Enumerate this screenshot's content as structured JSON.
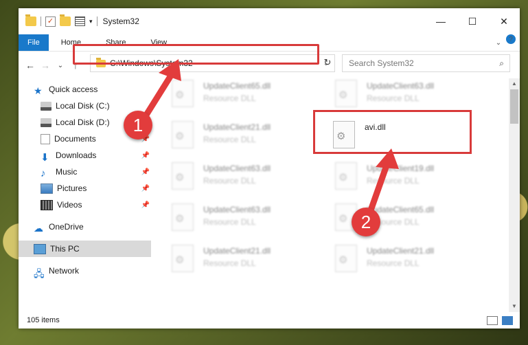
{
  "window": {
    "title": "System32",
    "quick_access_sep": "|",
    "controls": {
      "minimize": "—",
      "maximize": "☐",
      "close": "✕"
    }
  },
  "ribbon": {
    "tabs": [
      "File",
      "Home",
      "Share",
      "View"
    ],
    "collapse_icon": "chevron-down-icon",
    "help": "?"
  },
  "navigation": {
    "back": "←",
    "forward": "→",
    "recent": "⌄",
    "up": "↑",
    "address": "C:\\Windows\\System32",
    "refresh": "↻",
    "search_placeholder": "Search System32"
  },
  "sidebar": [
    {
      "label": "Quick access",
      "icon": "star-icon"
    },
    {
      "label": "Local Disk (C:)",
      "icon": "disk-icon",
      "pinned": false
    },
    {
      "label": "Local Disk (D:)",
      "icon": "disk-icon",
      "pinned": false
    },
    {
      "label": "Documents",
      "icon": "documents-icon",
      "pinned": true
    },
    {
      "label": "Downloads",
      "icon": "download-icon",
      "pinned": true
    },
    {
      "label": "Music",
      "icon": "music-icon",
      "pinned": true
    },
    {
      "label": "Pictures",
      "icon": "pictures-icon",
      "pinned": true
    },
    {
      "label": "Videos",
      "icon": "videos-icon",
      "pinned": true
    },
    {
      "label": "OneDrive",
      "icon": "cloud-icon"
    },
    {
      "label": "This PC",
      "icon": "computer-icon",
      "selected": true
    },
    {
      "label": "Network",
      "icon": "network-icon"
    }
  ],
  "files": [
    {
      "name": "UpdateClient65.dll",
      "type": "Resource DLL"
    },
    {
      "name": "UpdateClient63.dll",
      "type": "Resource DLL"
    },
    {
      "name": "UpdateClient21.dll",
      "type": "Resource DLL"
    },
    {
      "name": "avi.dll",
      "type": ""
    },
    {
      "name": "UpdateClient63.dll",
      "type": "Resource DLL"
    },
    {
      "name": "UpdateClient19.dll",
      "type": "Resource DLL"
    },
    {
      "name": "UpdateClient63.dll",
      "type": "Resource DLL"
    },
    {
      "name": "UpdateClient65.dll",
      "type": "Resource DLL"
    },
    {
      "name": "UpdateClient21.dll",
      "type": "Resource DLL"
    },
    {
      "name": "UpdateClient21.dll",
      "type": "Resource DLL"
    }
  ],
  "status": {
    "items": "105 items"
  },
  "annotations": {
    "step1": "1",
    "step2": "2",
    "color": "#e23c3c"
  }
}
